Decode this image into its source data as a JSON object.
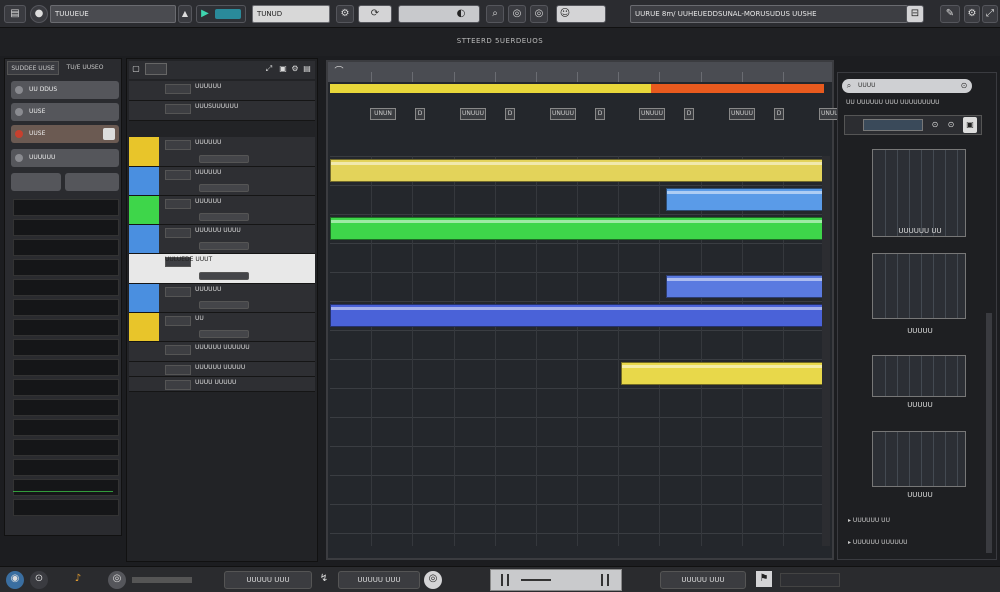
{
  "window": {
    "title": "STTEERD 5UERDEUOS"
  },
  "toolbar": {
    "project_field": "TUUUEUE",
    "module_field": "TUNUD",
    "status_field": "UURUE 8m/ UUHEUEDDSUNAL-MORUSUDUS UUSHE",
    "icons": [
      "menu-icon",
      "record-icon",
      "metronome-icon",
      "play-icon",
      "settings-icon",
      "loop-icon",
      "zoom-icon",
      "search-icon",
      "grid-icon",
      "window-icon",
      "user-icon",
      "close-icon"
    ]
  },
  "left_panel": {
    "tabs": [
      "SUDDEE UUSE",
      "TU/E UUSEO"
    ],
    "rows": [
      "UU DDUS",
      "UUSE",
      "UUSE",
      "UUUUUU"
    ],
    "accent": "#c8402e"
  },
  "tracks": [
    {
      "name": "UUUUUU",
      "color": "#2e2f33"
    },
    {
      "name": "UUUSUUUUUU",
      "color": "#2e2f33"
    },
    {
      "name": "UUUUUU",
      "color": "#e8c52a"
    },
    {
      "name": "UUUUUU",
      "color": "#4a8fe0"
    },
    {
      "name": "UUUUUU",
      "color": "#3ed64a"
    },
    {
      "name": "UUUUUU UUUU",
      "color": "#4a8fe0"
    },
    {
      "name": "UULUEDE UUUT",
      "color": "#e8e8e8"
    },
    {
      "name": "UUUUUU",
      "color": "#4a8fe0"
    },
    {
      "name": "UU",
      "color": "#e8c52a"
    },
    {
      "name": "UUUUUU UUUUUU",
      "color": "#2e2f33"
    },
    {
      "name": "UUUUUU UUUUU",
      "color": "#2e2f33"
    },
    {
      "name": "UUUU UUUUU",
      "color": "#2e2f33"
    }
  ],
  "arrange": {
    "markers": [
      {
        "color": "#e8d73a",
        "from": 0,
        "to": 0.65
      },
      {
        "color": "#e85a1e",
        "from": 0.65,
        "to": 1.0
      }
    ],
    "locators": [
      "UNUN",
      "D",
      "UNUUU",
      "D",
      "UNUUU",
      "D",
      "UNUUU",
      "D",
      "UNUUU",
      "D",
      "UNUUU"
    ],
    "clips": [
      {
        "lane": 0,
        "from": 0.0,
        "to": 1.0,
        "color": "#e3d35a"
      },
      {
        "lane": 1,
        "from": 0.68,
        "to": 1.0,
        "color": "#5a9be8"
      },
      {
        "lane": 2,
        "from": 0.0,
        "to": 1.0,
        "color": "#3ed64a"
      },
      {
        "lane": 4,
        "from": 0.68,
        "to": 1.0,
        "color": "#5a7ae0"
      },
      {
        "lane": 5,
        "from": 0.0,
        "to": 1.0,
        "color": "#4a62d8"
      },
      {
        "lane": 7,
        "from": 0.59,
        "to": 1.0,
        "color": "#e8d84a"
      }
    ]
  },
  "right_panel": {
    "search_placeholder": "UUUU",
    "filter_label": "UU UUUUUU UUU UUUUUUUUU",
    "thumbs": [
      "UUUUUU UU",
      "UUUUU",
      "UUUUU",
      "UUUUU"
    ],
    "list_items": [
      "UUUUUU UU",
      "UUUUUU UUUUUU"
    ]
  },
  "bottom": {
    "fields": [
      "UUUUU UUU",
      "UUUUU UUU",
      "UUUUU UUU"
    ],
    "icons": [
      "stop-icon",
      "home-icon",
      "audio-icon",
      "monitor-icon",
      "rewind-icon",
      "forward-icon"
    ]
  }
}
